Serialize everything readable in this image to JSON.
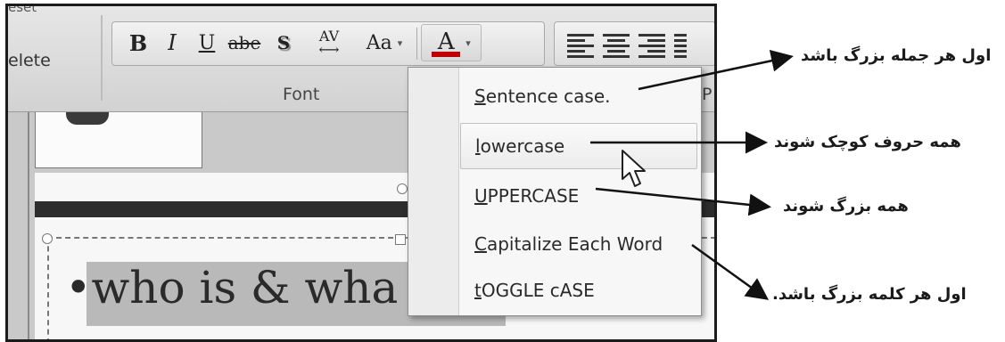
{
  "ribbon": {
    "reset_label": "eset",
    "delete_label": "elete",
    "font_group_label": "Font",
    "paragraph_group_label": "P",
    "bold_label": "B",
    "italic_label": "I",
    "underline_label": "U",
    "strikethrough_label": "abe",
    "shadow_label": "S",
    "spacing_label": "AV",
    "change_case_label": "Aa",
    "font_color_label": "A",
    "font_color": "#c00000"
  },
  "slide": {
    "bullet": "•",
    "body_text": "who is & wha"
  },
  "case_menu": {
    "items": [
      {
        "first": "S",
        "rest": "entence case."
      },
      {
        "first": "l",
        "rest": "owercase"
      },
      {
        "first": "U",
        "rest": "PPERCASE"
      },
      {
        "first": "C",
        "rest": "apitalize Each Word"
      },
      {
        "first": "t",
        "rest": "OGGLE cASE"
      }
    ]
  },
  "annotations": [
    "اول هر جمله بزرگ باشد",
    "همه حروف کوچک شوند",
    "همه بزرگ شوند",
    "اول هر کلمه بزرگ باشد."
  ]
}
